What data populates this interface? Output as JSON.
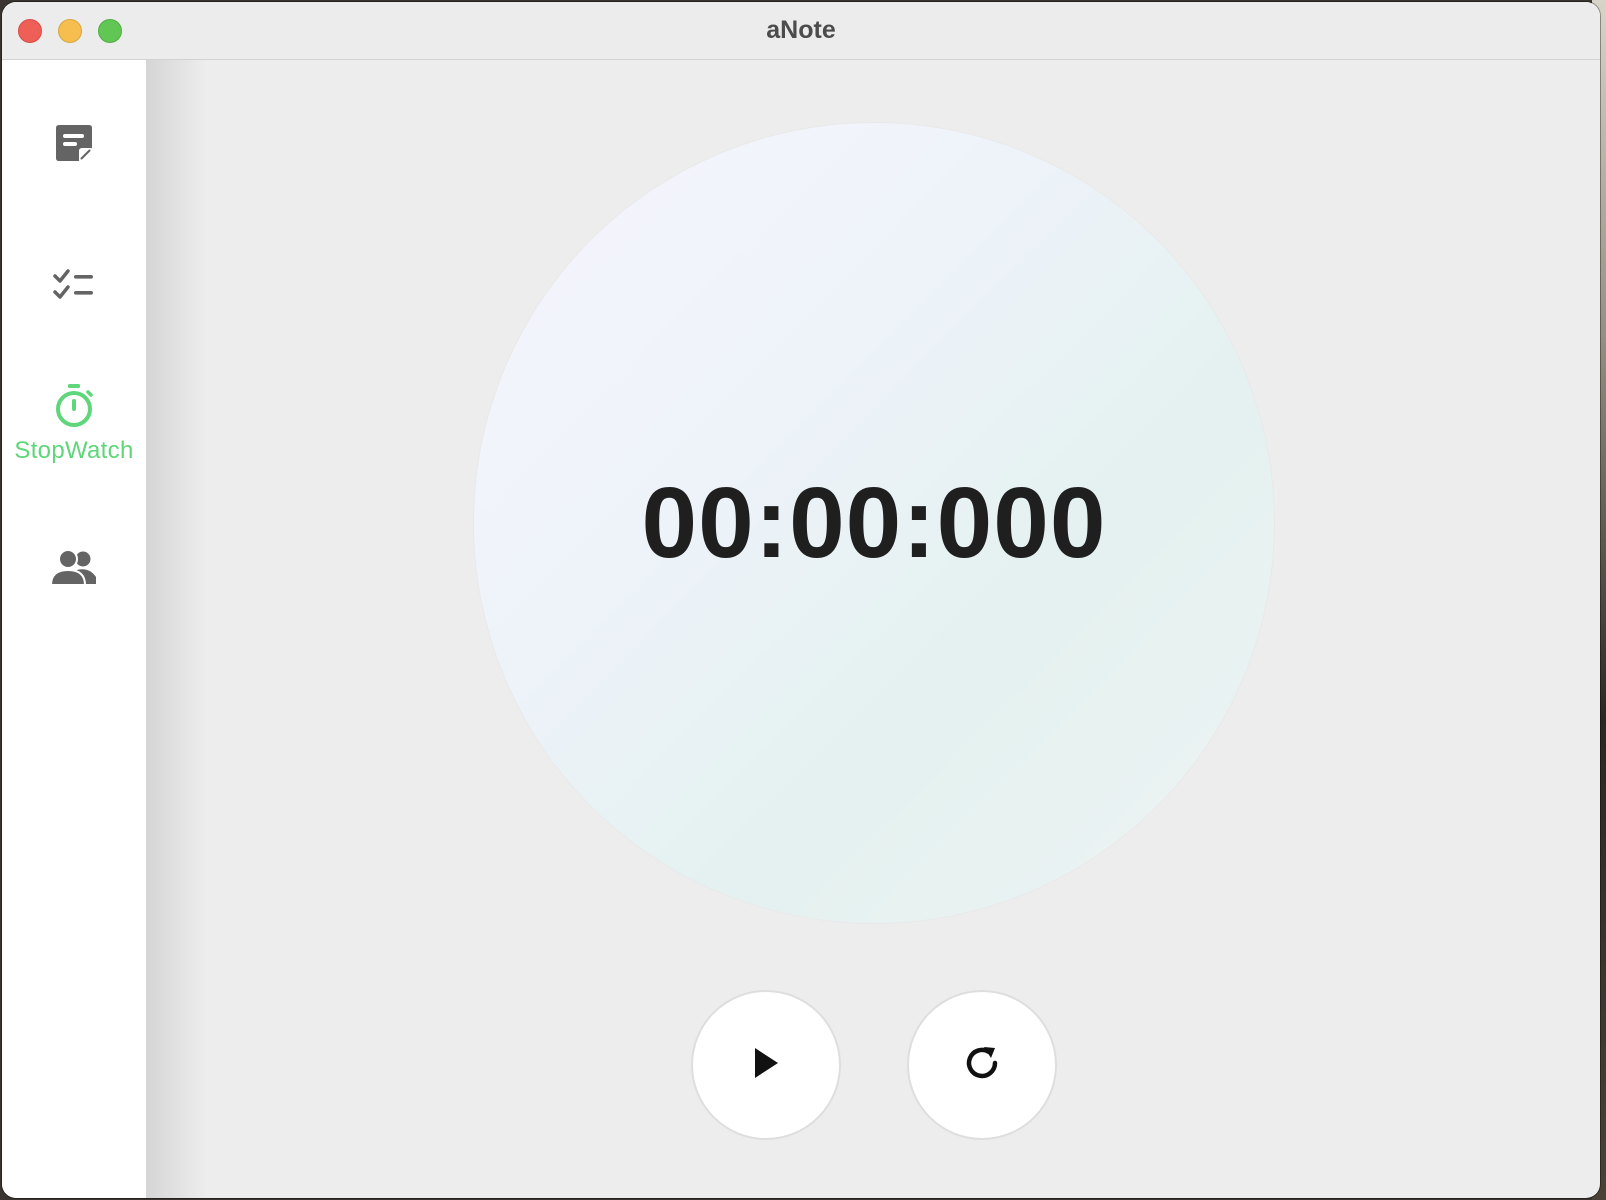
{
  "window": {
    "title": "aNote"
  },
  "sidebar": {
    "items": [
      {
        "id": "notes",
        "icon": "note-icon",
        "label": "",
        "active": false
      },
      {
        "id": "todo",
        "icon": "checklist-icon",
        "label": "",
        "active": false
      },
      {
        "id": "stopwatch",
        "icon": "stopwatch-icon",
        "label": "StopWatch",
        "active": true
      },
      {
        "id": "contacts",
        "icon": "people-icon",
        "label": "",
        "active": false
      }
    ]
  },
  "stopwatch": {
    "display": "00:00:000",
    "controls": [
      {
        "id": "start",
        "icon": "play-icon"
      },
      {
        "id": "reset",
        "icon": "refresh-icon"
      }
    ]
  },
  "colors": {
    "accent": "#5fd67a",
    "icon_gray": "#646464",
    "window_bg": "#ededed",
    "sidebar_bg": "#ffffff",
    "traffic_close": "#ee5f57",
    "traffic_minimize": "#f6be4f",
    "traffic_maximize": "#62c655"
  }
}
